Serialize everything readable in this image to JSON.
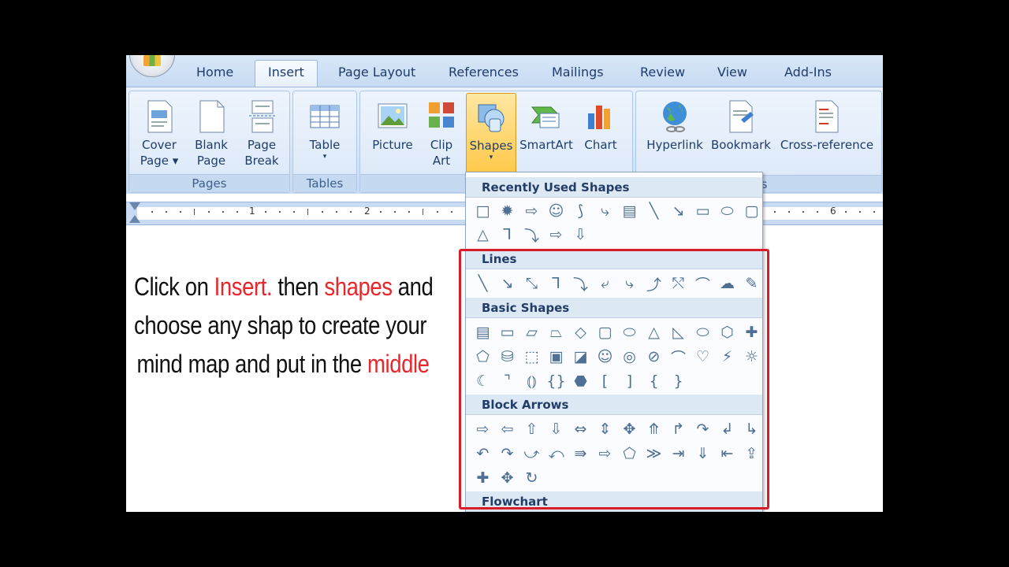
{
  "tabs": [
    {
      "label": "Home",
      "active": false
    },
    {
      "label": "Insert",
      "active": true
    },
    {
      "label": "Page Layout",
      "active": false
    },
    {
      "label": "References",
      "active": false
    },
    {
      "label": "Mailings",
      "active": false
    },
    {
      "label": "Review",
      "active": false
    },
    {
      "label": "View",
      "active": false
    },
    {
      "label": "Add-Ins",
      "active": false
    }
  ],
  "ribbon": {
    "groups": {
      "pages": "Pages",
      "tables": "Tables",
      "illustrations_partial": "I",
      "links_partial": "ks"
    },
    "buttons": {
      "cover_page": [
        "Cover",
        "Page ▾"
      ],
      "blank_page": [
        "Blank",
        "Page"
      ],
      "page_break": [
        "Page",
        "Break"
      ],
      "table": "Table",
      "picture": "Picture",
      "clip_art": [
        "Clip",
        "Art"
      ],
      "shapes": "Shapes",
      "smartart": "SmartArt",
      "chart": "Chart",
      "hyperlink": "Hyperlink",
      "bookmark": "Bookmark",
      "cross_reference": "Cross-reference"
    }
  },
  "ruler": {
    "numbers": [
      "1",
      "2",
      "6"
    ]
  },
  "instruction": {
    "line1": [
      {
        "text": "Click on ",
        "red": false
      },
      {
        "text": "Insert.",
        "red": true
      },
      {
        "text": " then ",
        "red": false
      },
      {
        "text": "shapes",
        "red": true
      },
      {
        "text": " and",
        "red": false
      }
    ],
    "line2": "choose any shap to create your",
    "line3_pre": "mind map and put in the ",
    "line3_red": "middle"
  },
  "shapes_menu": {
    "sections": {
      "recent": "Recently Used Shapes",
      "lines": "Lines",
      "basic": "Basic Shapes",
      "block_arrows": "Block Arrows",
      "flowchart": "Flowchart"
    },
    "recent_row1": [
      "□",
      "✹",
      "⇨",
      "☺",
      "⟆",
      "⤷",
      "▤",
      "╲",
      "↘",
      "▭",
      "⬭",
      "▢"
    ],
    "recent_row2": [
      "△",
      "⅂",
      "⤵",
      "⇨",
      "⇩"
    ],
    "lines_row": [
      "╲",
      "↘",
      "⤡",
      "⅂",
      "⤵",
      "⤶",
      "⤷",
      "⤴",
      "⤲",
      "⌒",
      "☁",
      "✎"
    ],
    "basic_row1": [
      "▤",
      "▭",
      "▱",
      "⏢",
      "◇",
      "▢",
      "⬭",
      "△",
      "◺",
      "⬭",
      "⬡",
      "✚"
    ],
    "basic_row2": [
      "⬠",
      "⛁",
      "⬚",
      "▣",
      "◪",
      "☺",
      "◎",
      "⊘",
      "⌒",
      "♡",
      "⚡",
      "☼"
    ],
    "basic_row3": [
      "☾",
      "⌝",
      "⦅⦆",
      "{}",
      "⬣",
      "[",
      "]",
      "{",
      "}"
    ],
    "arrows_row1": [
      "⇨",
      "⇦",
      "⇧",
      "⇩",
      "⇔",
      "⇕",
      "✥",
      "⤊",
      "↱",
      "↷",
      "↲",
      "↳"
    ],
    "arrows_row2": [
      "↶",
      "↷",
      "⤻",
      "⤺",
      "⇛",
      "⇨",
      "⬠",
      "≫",
      "⇥",
      "⇓",
      "⇤",
      "⇪"
    ],
    "arrows_row3": [
      "✚",
      "✥",
      "↻"
    ]
  },
  "colors": {
    "highlight_red": "#e8262b",
    "callout_box": "#d81c2a",
    "ribbon_blue": "#c7dbf3"
  }
}
